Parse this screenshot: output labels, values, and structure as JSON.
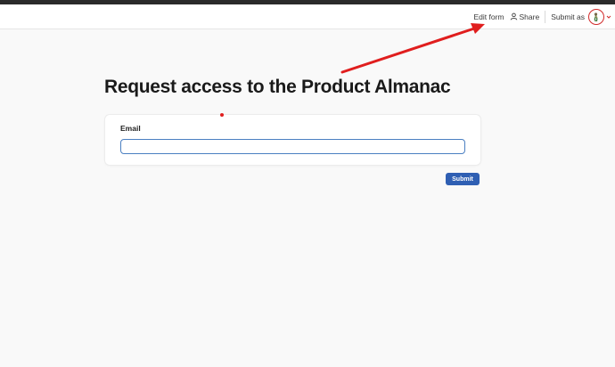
{
  "header": {
    "edit_form_label": "Edit form",
    "share_label": "Share",
    "submit_as_label": "Submit as",
    "share_icon": "person-icon",
    "avatar_icon": "user-avatar-icon"
  },
  "form": {
    "title": "Request access to the Product Almanac",
    "fields": [
      {
        "label": "Email",
        "value": ""
      }
    ],
    "submit_label": "Submit"
  },
  "colors": {
    "accent": "#2f5fb3",
    "input_border": "#4a7fc1",
    "annotation": "#e01e1e"
  }
}
